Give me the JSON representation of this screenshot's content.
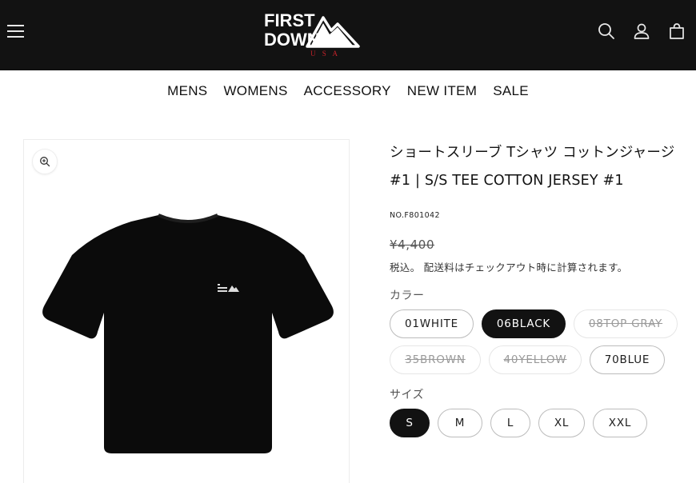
{
  "header": {
    "logo": {
      "line1": "FIRST",
      "line2": "DOWN",
      "sub": "U S A"
    },
    "icons": [
      "menu-icon",
      "search-icon",
      "account-icon",
      "cart-icon"
    ],
    "bg": "#121212"
  },
  "nav": {
    "items": [
      "MENS",
      "WOMENS",
      "ACCESSORY",
      "NEW ITEM",
      "SALE"
    ]
  },
  "media": {
    "zoom_icon": "zoom-in-icon",
    "product_color": "#0b0b0b"
  },
  "product": {
    "title": "ショートスリーブ Tシャツ コットンジャージ #1 | S/S TEE COTTON JERSEY #1",
    "sku": "NO.F801042",
    "price": "¥4,400",
    "tax_note": "税込。 配送料はチェックアウト時に計算されます。",
    "color_label": "カラー",
    "colors": [
      {
        "label": "01WHITE",
        "state": "available"
      },
      {
        "label": "06BLACK",
        "state": "selected"
      },
      {
        "label": "08TOP GRAY",
        "state": "sold-out"
      },
      {
        "label": "35BROWN",
        "state": "sold-out"
      },
      {
        "label": "40YELLOW",
        "state": "sold-out"
      },
      {
        "label": "70BLUE",
        "state": "available"
      }
    ],
    "size_label": "サイズ",
    "sizes": [
      {
        "label": "S",
        "state": "selected"
      },
      {
        "label": "M",
        "state": "available"
      },
      {
        "label": "L",
        "state": "available"
      },
      {
        "label": "XL",
        "state": "available"
      },
      {
        "label": "XXL",
        "state": "available"
      }
    ]
  }
}
